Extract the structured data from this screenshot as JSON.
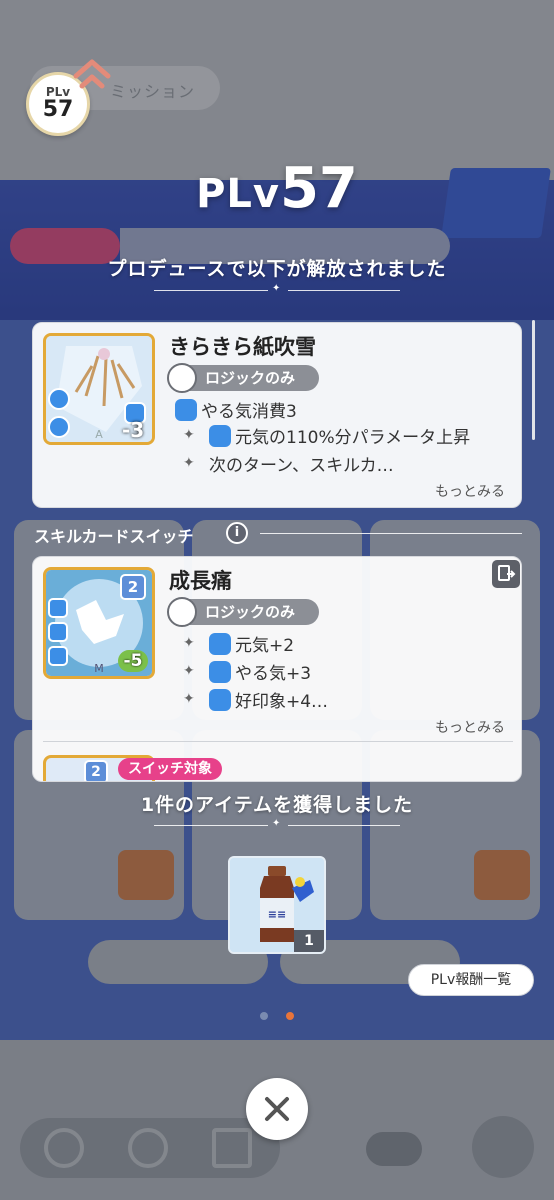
{
  "header": {
    "plv_label": "PLv",
    "plv_value": "57",
    "mission_label": "ミッション"
  },
  "title": {
    "prefix": "PLv",
    "level": "57"
  },
  "unlock_message": "プロデュースで以下が解放されました",
  "unlocked_card": {
    "name": "きらきら紙吹雪",
    "tag": "ロジックのみ",
    "cost": "-3",
    "effects": [
      "やる気消費3",
      "元気の110%分パラメータ上昇",
      "次のターン、スキルカ…"
    ],
    "more": "もっとみる"
  },
  "switch_section": {
    "label": "スキルカードスイッチ",
    "info": "i",
    "card": {
      "name": "成長痛",
      "tag": "ロジックのみ",
      "level": "2",
      "cost": "-5",
      "effects": [
        "元気+2",
        "やる気+3",
        "好印象+4…"
      ],
      "more": "もっとみる"
    },
    "next_card_level": "2",
    "next_card_badge": "スイッチ対象"
  },
  "items_message": "1件のアイテムを獲得しました",
  "item": {
    "quantity": "1"
  },
  "buttons": {
    "reward_list": "PLv報酬一覧",
    "close": "✕"
  },
  "colors": {
    "accent_pink": "#e7418a",
    "card_border_gold": "#e3a937",
    "effect_blue": "#3c8ee6"
  }
}
